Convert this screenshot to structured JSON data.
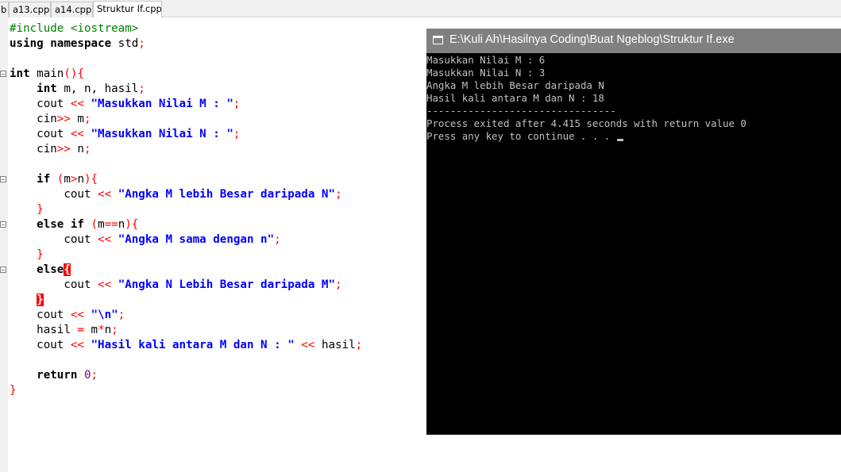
{
  "tabs": [
    {
      "label": "b",
      "active": false
    },
    {
      "label": "a13.cpp",
      "active": false
    },
    {
      "label": "a14.cpp",
      "active": false
    },
    {
      "label": "Struktur If.cpp",
      "active": true
    }
  ],
  "code": {
    "include": "#include <iostream>",
    "using_kw": "using namespace",
    "using_std": " std",
    "semi": ";",
    "int_kw": "int",
    "main_name": " main",
    "open_paren_brace": "(){",
    "indent": "    ",
    "indent2": "        ",
    "decl_vars": " m, n, hasil",
    "cout": "cout",
    "cin": "cin",
    "out_op": " << ",
    "in_op": ">>",
    "str_masuk_m": "\"Masukkan Nilai M : \"",
    "str_masuk_n": "\"Masukkan Nilai N : \"",
    "var_m": " m",
    "var_n": " n",
    "if_kw": "if",
    "if_cond_open": " (",
    "if_cond_m": "m",
    "if_cond_gt": ">",
    "if_cond_n": "n",
    "close_paren_brace": "){",
    "str_m_besar": "\"Angka M lebih Besar daripada N\"",
    "close_brace": "}",
    "open_brace": "{",
    "else_if_kw": "else if",
    "eq_op": "==",
    "str_m_sama": "\"Angka M sama dengan n\"",
    "else_kw": "else",
    "str_n_besar": "\"Angka N Lebih Besar daripada M\"",
    "str_newline": "\"\\n\"",
    "hasil_lhs": "hasil ",
    "assign": "=",
    "mul_m": " m",
    "mul_op": "*",
    "mul_n": "n",
    "str_hasil": "\"Hasil kali antara M dan N : \"",
    "var_hasil": "hasil",
    "return_kw": "return",
    "zero": "0"
  },
  "console": {
    "title": "E:\\Kuli Ah\\Hasilnya Coding\\Buat Ngeblog\\Struktur If.exe",
    "lines": [
      "Masukkan Nilai M : 6",
      "Masukkan Nilai N : 3",
      "Angka M lebih Besar daripada N",
      "Hasil kali antara M dan N : 18",
      "--------------------------------",
      "Process exited after 4.415 seconds with return value 0",
      "Press any key to continue . . . "
    ]
  }
}
